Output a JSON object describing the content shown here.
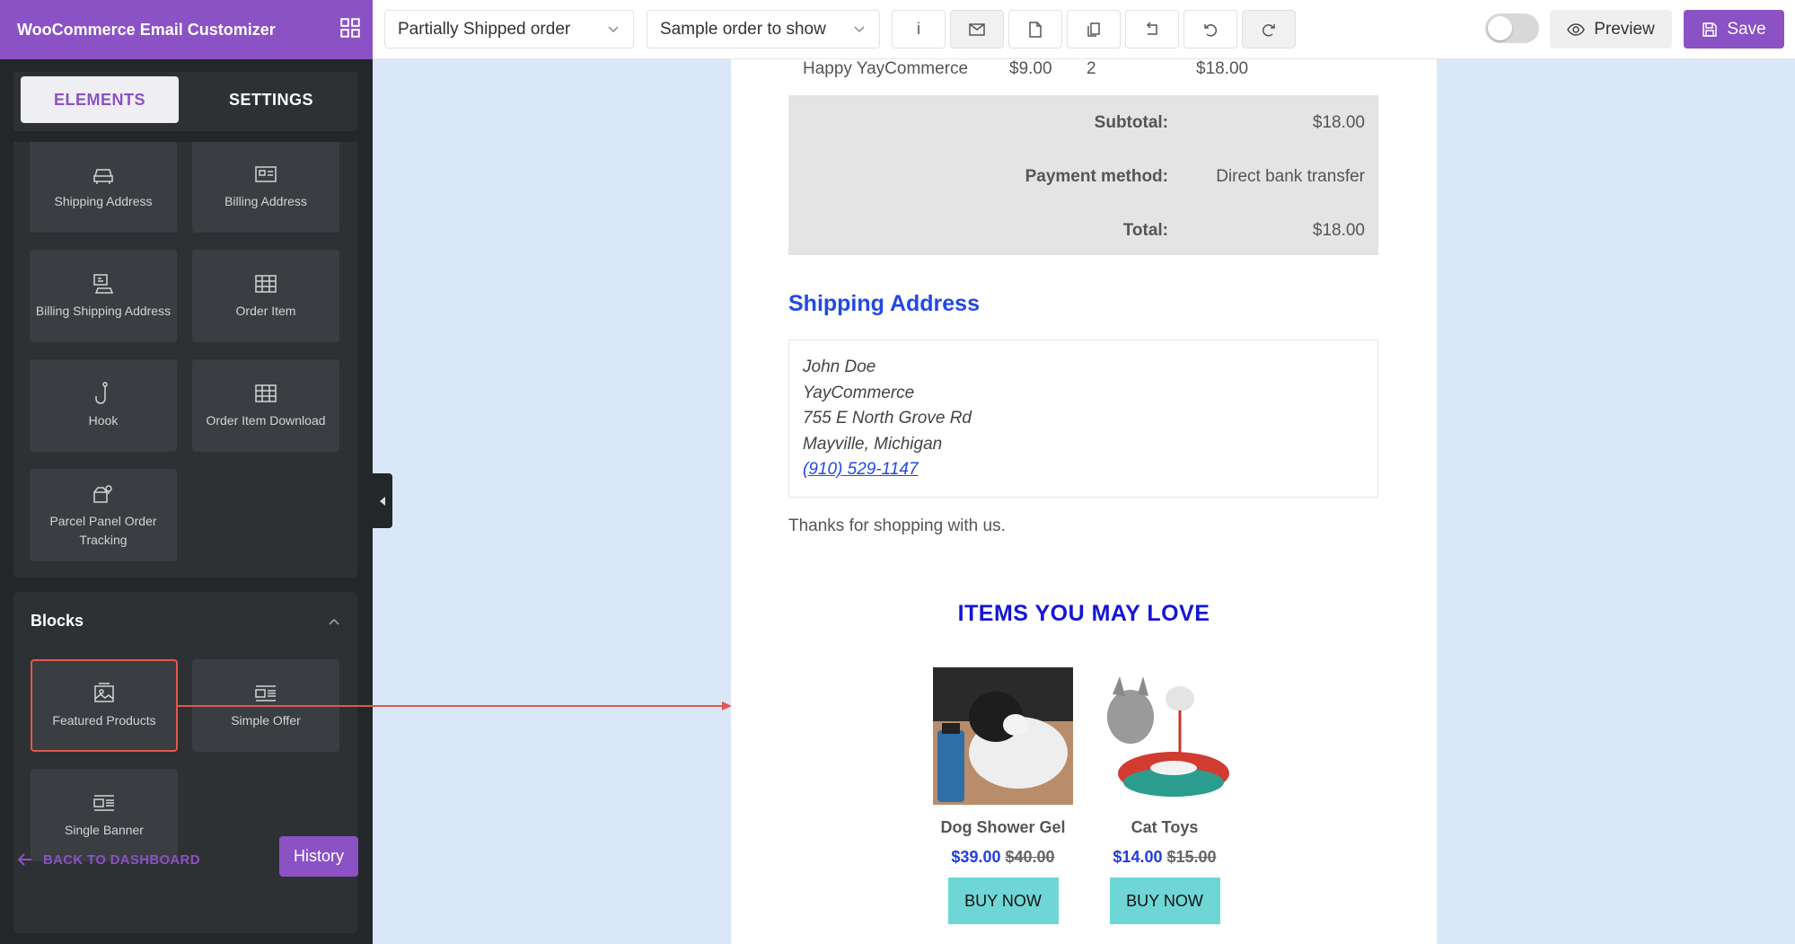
{
  "app": {
    "title": "WooCommerce Email Customizer"
  },
  "toolbar": {
    "email_type": "Partially Shipped order",
    "sample_order": "Sample order to show",
    "preview_label": "Preview",
    "save_label": "Save",
    "toggle_on": false
  },
  "sidebar": {
    "tabs": [
      {
        "label": "ELEMENTS",
        "active": true
      },
      {
        "label": "SETTINGS",
        "active": false
      }
    ],
    "elements": [
      {
        "label": "Shipping Address",
        "icon": "car-icon"
      },
      {
        "label": "Billing Address",
        "icon": "id-card-icon"
      },
      {
        "label": "Billing Shipping Address",
        "icon": "address-card-icon"
      },
      {
        "label": "Order Item",
        "icon": "table-icon"
      },
      {
        "label": "Hook",
        "icon": "hook-icon"
      },
      {
        "label": "Order Item Download",
        "icon": "table-icon"
      },
      {
        "label": "Parcel Panel Order Tracking",
        "icon": "parcel-tracking-icon"
      }
    ],
    "blocks_title": "Blocks",
    "blocks": [
      {
        "label": "Featured Products",
        "icon": "image-icon",
        "selected": true
      },
      {
        "label": "Simple Offer",
        "icon": "layout-icon",
        "selected": false
      },
      {
        "label": "Single Banner",
        "icon": "layout-icon",
        "selected": false
      }
    ],
    "back_label": "BACK TO DASHBOARD",
    "history_label": "History"
  },
  "email": {
    "line_item": {
      "name": "Happy YayCommerce",
      "price": "$9.00",
      "qty": "2",
      "total": "$18.00"
    },
    "totals": [
      {
        "label": "Subtotal:",
        "value": "$18.00"
      },
      {
        "label": "Payment method:",
        "value": "Direct bank transfer"
      },
      {
        "label": "Total:",
        "value": "$18.00"
      }
    ],
    "shipping_title": "Shipping Address",
    "address": {
      "name": "John Doe",
      "company": "YayCommerce",
      "street": "755 E North Grove Rd",
      "city": "Mayville, Michigan",
      "phone": "(910) 529-1147"
    },
    "thanks": "Thanks for shopping with us.",
    "featured_title": "ITEMS YOU MAY LOVE",
    "products": [
      {
        "name": "Dog Shower Gel",
        "price": "$39.00",
        "old_price": "$40.00",
        "button": "BUY NOW"
      },
      {
        "name": "Cat Toys",
        "price": "$14.00",
        "old_price": "$15.00",
        "button": "BUY NOW"
      }
    ]
  },
  "colors": {
    "brand": "#8a52c5",
    "link": "#2149e3",
    "buy_button": "#6fd6d6",
    "highlight": "#e0584d"
  }
}
